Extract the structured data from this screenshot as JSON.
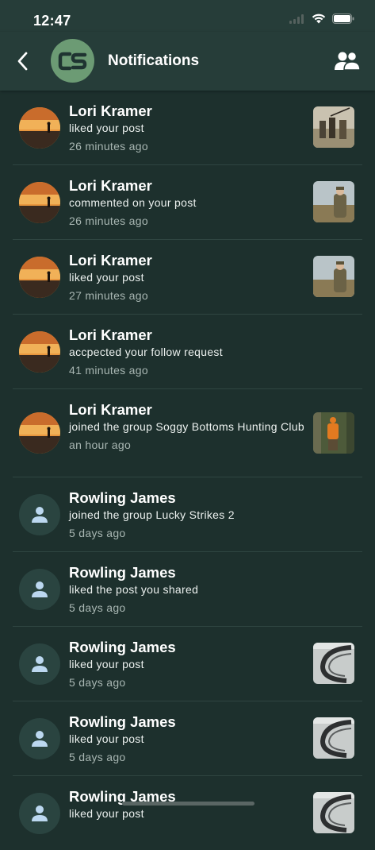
{
  "status_bar": {
    "time": "12:47"
  },
  "header": {
    "title": "Notifications",
    "logo_text": "CS"
  },
  "notifications": [
    {
      "name": "Lori Kramer",
      "action": "liked your post",
      "time": "26 minutes ago",
      "avatar": "sunset-photo",
      "thumb": "hunters-photo"
    },
    {
      "name": "Lori Kramer",
      "action": "commented on your post",
      "time": "26 minutes ago",
      "avatar": "sunset-photo",
      "thumb": "camo-hunter-photo"
    },
    {
      "name": "Lori Kramer",
      "action": "liked your post",
      "time": "27 minutes ago",
      "avatar": "sunset-photo",
      "thumb": "camo-hunter-photo"
    },
    {
      "name": "Lori Kramer",
      "action": "accpected your follow request",
      "time": "41 minutes ago",
      "avatar": "sunset-photo",
      "thumb": ""
    },
    {
      "name": "Lori Kramer",
      "action": "joined the group Soggy Bottoms Hunting Club",
      "time": "an hour ago",
      "avatar": "sunset-photo",
      "thumb": "orange-vest-photo"
    },
    {
      "name": "Rowling James",
      "action": "joined the group Lucky Strikes 2",
      "time": "5 days ago",
      "avatar": "default-person-icon",
      "thumb": ""
    },
    {
      "name": "Rowling James",
      "action": "liked the post you shared",
      "time": "5 days ago",
      "avatar": "default-person-icon",
      "thumb": ""
    },
    {
      "name": "Rowling James",
      "action": "liked your post",
      "time": "5 days ago",
      "avatar": "default-person-icon",
      "thumb": "bow-photo"
    },
    {
      "name": "Rowling James",
      "action": "liked your post",
      "time": "5 days ago",
      "avatar": "default-person-icon",
      "thumb": "bow-photo"
    },
    {
      "name": "Rowling James",
      "action": "liked your post",
      "time": "",
      "avatar": "default-person-icon",
      "thumb": "bow-photo"
    }
  ],
  "colors": {
    "background": "#1d302d",
    "header": "#263d39",
    "logo": "#6c9b74",
    "person_icon": "#bcd8f0"
  }
}
